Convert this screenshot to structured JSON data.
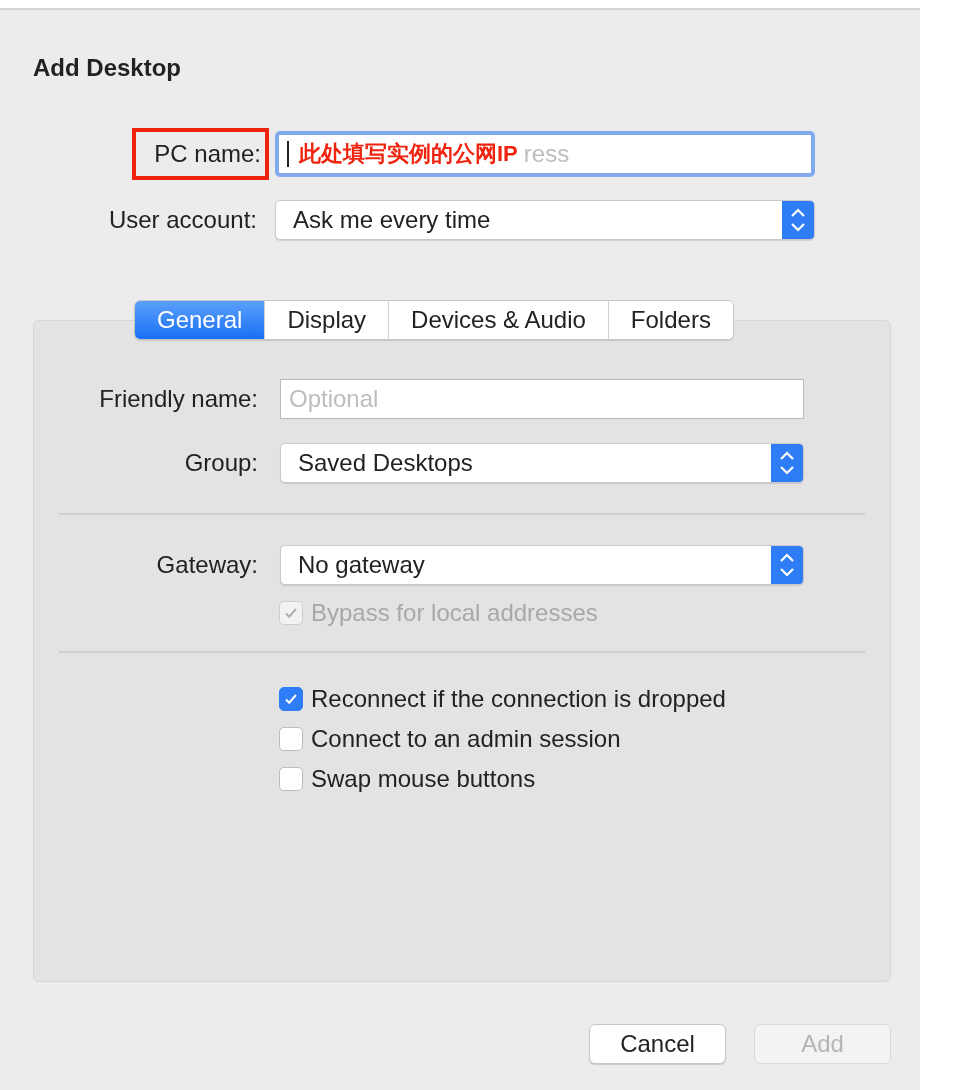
{
  "title": "Add Desktop",
  "pc_name": {
    "label": "PC name:",
    "highlighted": true,
    "annotation": "此处填写实例的公网IP",
    "placeholder_tail": "ress"
  },
  "user_account": {
    "label": "User account:",
    "value": "Ask me every time"
  },
  "tabs": [
    {
      "label": "General",
      "selected": true
    },
    {
      "label": "Display",
      "selected": false
    },
    {
      "label": "Devices & Audio",
      "selected": false
    },
    {
      "label": "Folders",
      "selected": false
    }
  ],
  "friendly_name": {
    "label": "Friendly name:",
    "placeholder": "Optional"
  },
  "group": {
    "label": "Group:",
    "value": "Saved Desktops"
  },
  "gateway": {
    "label": "Gateway:",
    "value": "No gateway"
  },
  "bypass": {
    "label": "Bypass for local addresses",
    "checked": true,
    "disabled": true
  },
  "options": [
    {
      "label": "Reconnect if the connection is dropped",
      "checked": true,
      "disabled": false
    },
    {
      "label": "Connect to an admin session",
      "checked": false,
      "disabled": false
    },
    {
      "label": "Swap mouse buttons",
      "checked": false,
      "disabled": false
    }
  ],
  "buttons": [
    {
      "label": "Cancel",
      "disabled": false
    },
    {
      "label": "Add",
      "disabled": true
    }
  ]
}
